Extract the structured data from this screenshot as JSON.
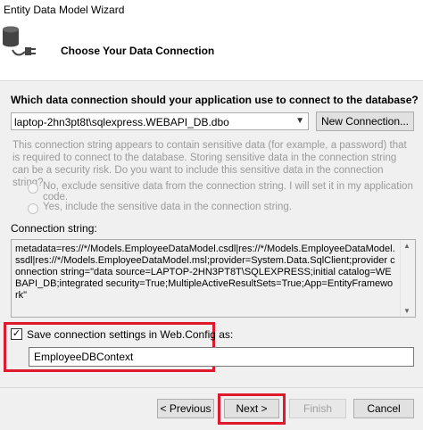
{
  "window": {
    "title": "Entity Data Model Wizard"
  },
  "header": {
    "heading": "Choose Your Data Connection",
    "icon": "database-plug-icon"
  },
  "connection": {
    "question": "Which data connection should your application use to connect to the database?",
    "selected": "laptop-2hn3pt8t\\sqlexpress.WEBAPI_DB.dbo",
    "new_connection_label": "New Connection...",
    "sensitive_text": "This connection string appears to contain sensitive data (for example, a password) that is required to connect to the database. Storing sensitive data in the connection string can be a security risk. Do you want to include this sensitive data in the connection string?",
    "option_exclude": "No, exclude sensitive data from the connection string. I will set it in my application code.",
    "option_include": "Yes, include the sensitive data in the connection string.",
    "string_label": "Connection string:",
    "string_value": "metadata=res://*/Models.EmployeeDataModel.csdl|res://*/Models.EmployeeDataModel.ssdl|res://*/Models.EmployeeDataModel.msl;provider=System.Data.SqlClient;provider connection string=\"data source=LAPTOP-2HN3PT8T\\SQLEXPRESS;initial catalog=WEBAPI_DB;integrated security=True;MultipleActiveResultSets=True;App=EntityFramework\""
  },
  "save": {
    "checked": true,
    "label": "Save connection settings in Web.Config as:",
    "context_name": "EmployeeDBContext"
  },
  "footer": {
    "previous": "< Previous",
    "next": "Next >",
    "finish": "Finish",
    "cancel": "Cancel"
  },
  "colors": {
    "highlight": "#e01a2e",
    "disabled_text": "#9a9a9a",
    "dialog_bg": "#f0f0f0"
  }
}
